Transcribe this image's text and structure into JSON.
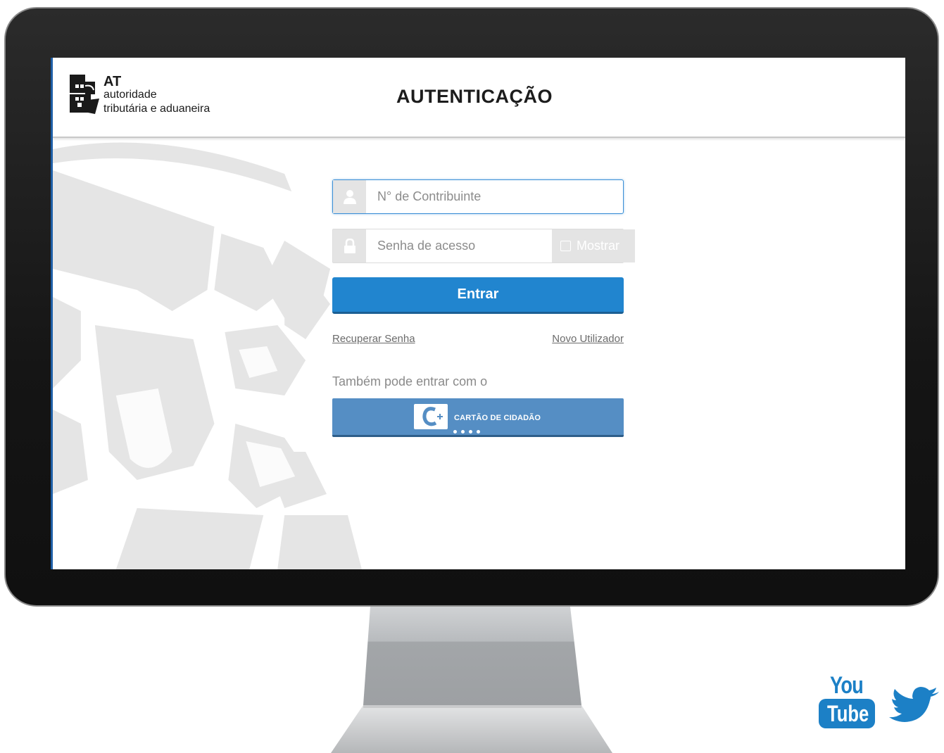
{
  "header": {
    "logo": {
      "acronym": "AT",
      "line1": "autoridade",
      "line2": "tributária e aduaneira"
    },
    "title": "AUTENTICAÇÃO"
  },
  "login": {
    "nif_placeholder": "N° de Contribuinte",
    "password_placeholder": "Senha de acesso",
    "show_password_label": "Mostrar",
    "submit_label": "Entrar",
    "recover_link": "Recuperar Senha",
    "new_user_link": "Novo Utilizador",
    "alt_login_text": "Também pode entrar com o",
    "citizen_card_label": "CARTÃO DE CIDADÃO"
  },
  "social": {
    "youtube": {
      "top": "You",
      "bottom": "Tube"
    },
    "twitter_icon": "twitter-bird-icon"
  },
  "colors": {
    "primary_button": "#2185cf",
    "citizen_card_button": "#558ec4",
    "social_blue": "#1c80c6",
    "focus_border": "#3b8fd6"
  }
}
